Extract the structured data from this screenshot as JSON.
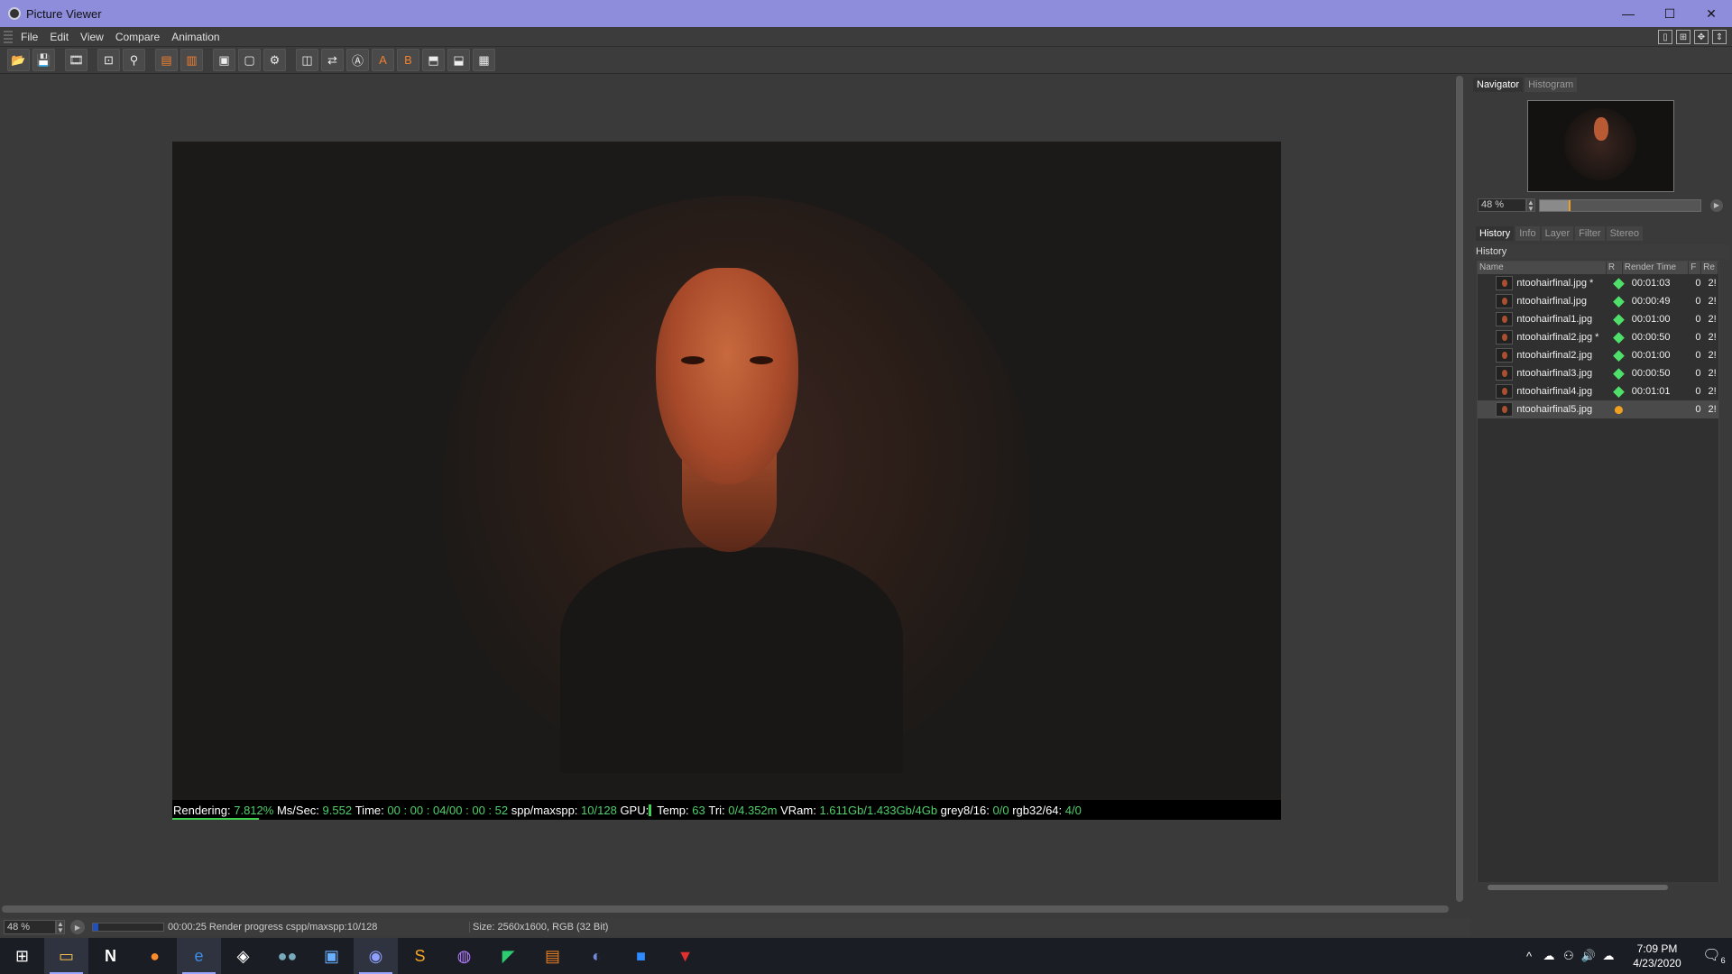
{
  "window": {
    "title": "Picture Viewer",
    "min": "—",
    "max": "☐",
    "close": "✕"
  },
  "menu": [
    "File",
    "Edit",
    "View",
    "Compare",
    "Animation"
  ],
  "status_line": {
    "rendering_label": "Rendering:",
    "rendering_val": "7.812%",
    "ms_label": "Ms/Sec:",
    "ms_val": "9.552",
    "time_label": "Time:",
    "time_val": "00 : 00 : 04/00 : 00 : 52",
    "spp_label": "spp/maxspp:",
    "spp_val": "10/128",
    "gpu_label": "GPU:",
    "temp_label": "Temp:",
    "temp_val": "63",
    "tri_label": "Tri:",
    "tri_val": "0/4.352m",
    "vram_label": "VRam:",
    "vram_val": "1.611Gb/1.433Gb/4Gb",
    "grey_label": "grey8/16:",
    "grey_val": "0/0",
    "rgb_label": "rgb32/64:",
    "rgb_val": "4/0",
    "progress_fraction": 0.078
  },
  "bottom": {
    "zoom": "48 %",
    "render_text": "00:00:25 Render progress  cspp/maxspp:10/128",
    "size_text": "Size: 2560x1600, RGB (32 Bit)",
    "render_progress_fraction": 0.08
  },
  "navigator": {
    "tabs": [
      "Navigator",
      "Histogram"
    ],
    "zoom": "48 %",
    "zoom_slider_fraction": 0.18
  },
  "panel": {
    "tabs": [
      "History",
      "Info",
      "Layer",
      "Filter",
      "Stereo"
    ],
    "header": "History",
    "columns": [
      "Name",
      "R",
      "Render Time",
      "F",
      "Re"
    ],
    "rows": [
      {
        "name": "ntoohairfinal.jpg *",
        "status": "done",
        "time": "00:01:03",
        "f": "0",
        "re": "2!"
      },
      {
        "name": "ntoohairfinal.jpg",
        "status": "done",
        "time": "00:00:49",
        "f": "0",
        "re": "2!"
      },
      {
        "name": "ntoohairfinal1.jpg",
        "status": "done",
        "time": "00:01:00",
        "f": "0",
        "re": "2!"
      },
      {
        "name": "ntoohairfinal2.jpg *",
        "status": "done",
        "time": "00:00:50",
        "f": "0",
        "re": "2!"
      },
      {
        "name": "ntoohairfinal2.jpg",
        "status": "done",
        "time": "00:01:00",
        "f": "0",
        "re": "2!"
      },
      {
        "name": "ntoohairfinal3.jpg",
        "status": "done",
        "time": "00:00:50",
        "f": "0",
        "re": "2!"
      },
      {
        "name": "ntoohairfinal4.jpg",
        "status": "done",
        "time": "00:01:01",
        "f": "0",
        "re": "2!"
      },
      {
        "name": "ntoohairfinal5.jpg",
        "status": "rendering",
        "time": "",
        "f": "0",
        "re": "2!"
      }
    ]
  },
  "taskbar": {
    "time": "7:09 PM",
    "date": "4/23/2020",
    "notification_count": "6"
  },
  "colors": {
    "titlebar": "#8e8ddc",
    "status_green": "#4fd06a",
    "status_orange": "#f0a020"
  }
}
